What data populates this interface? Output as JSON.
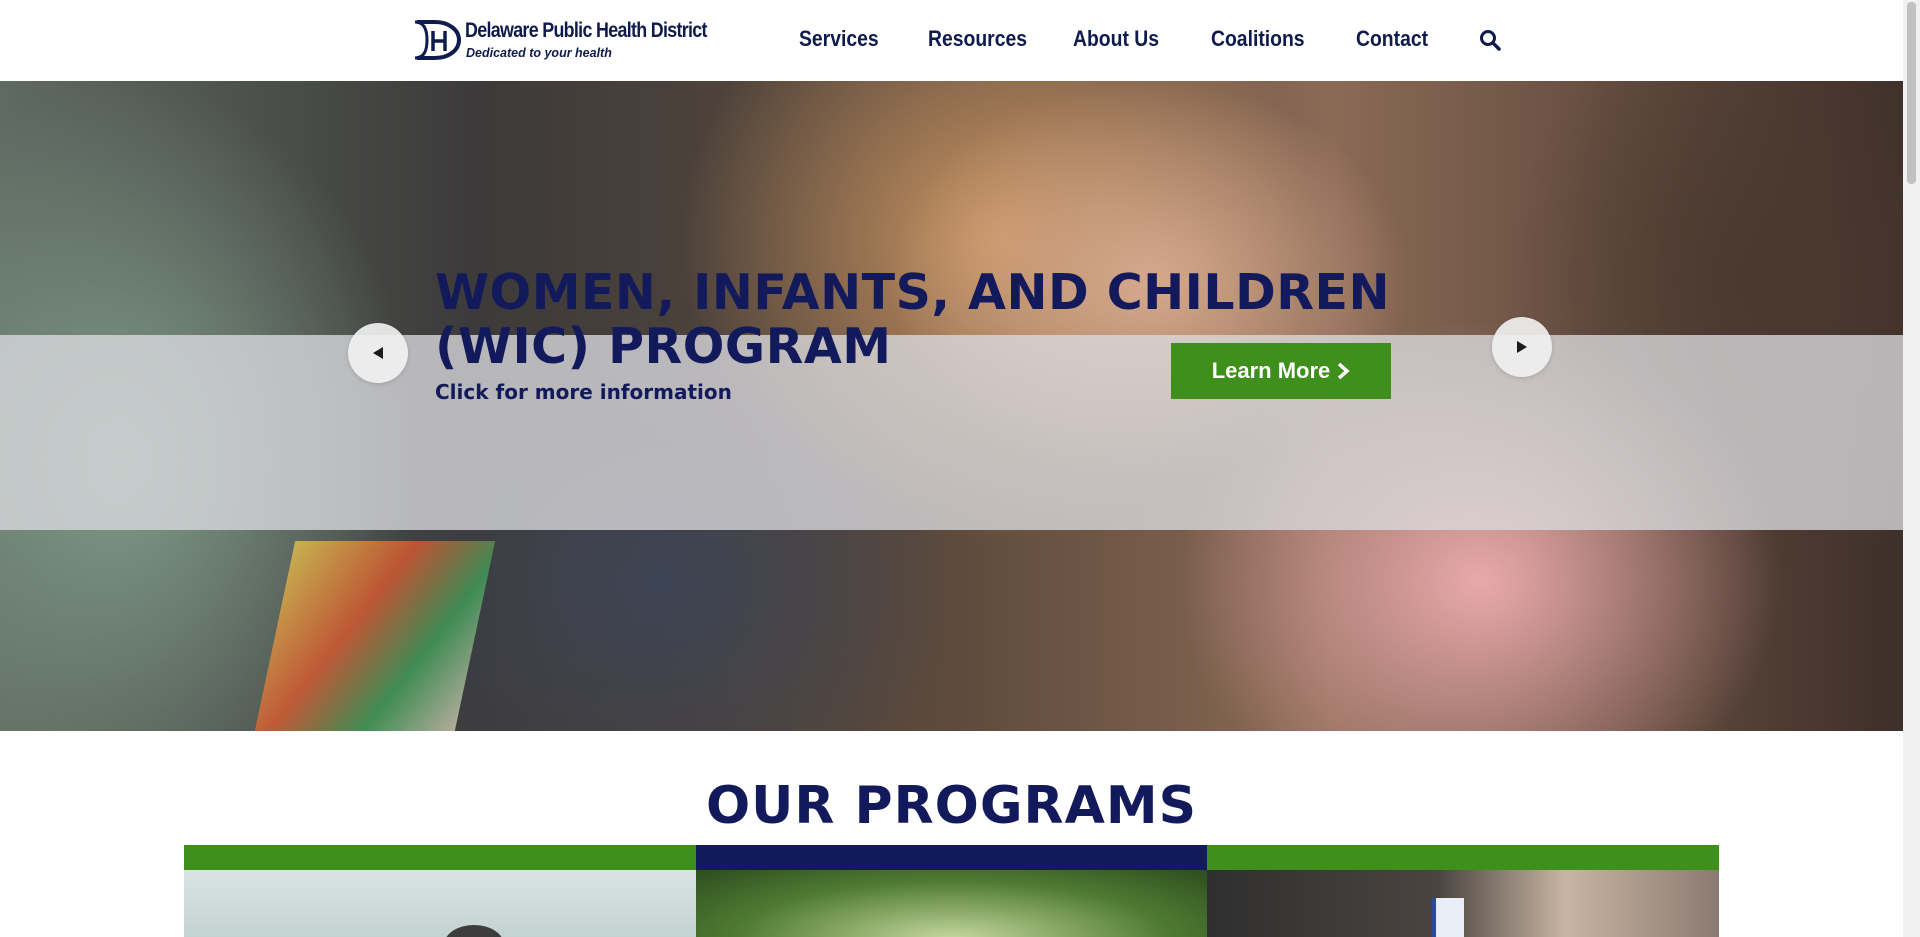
{
  "header": {
    "logo_name": "Delaware Public Health District",
    "logo_tagline": "Dedicated to your health",
    "nav": [
      {
        "label": "Services"
      },
      {
        "label": "Resources"
      },
      {
        "label": "About Us"
      },
      {
        "label": "Coalitions"
      },
      {
        "label": "Contact"
      }
    ]
  },
  "hero": {
    "title": "WOMEN, INFANTS, AND CHILDREN (WIC) PROGRAM",
    "subtitle": "Click for more information",
    "button_label": "Learn More"
  },
  "programs": {
    "title": "OUR PROGRAMS"
  },
  "colors": {
    "navy": "#131a5c",
    "green": "#3f8f1c",
    "card_bars": [
      "#3f8f1c",
      "#131a5c",
      "#3f8f1c"
    ]
  },
  "icons": [
    "search-icon",
    "chevron-left-icon",
    "chevron-right-icon",
    "chevron-right-small-icon"
  ]
}
